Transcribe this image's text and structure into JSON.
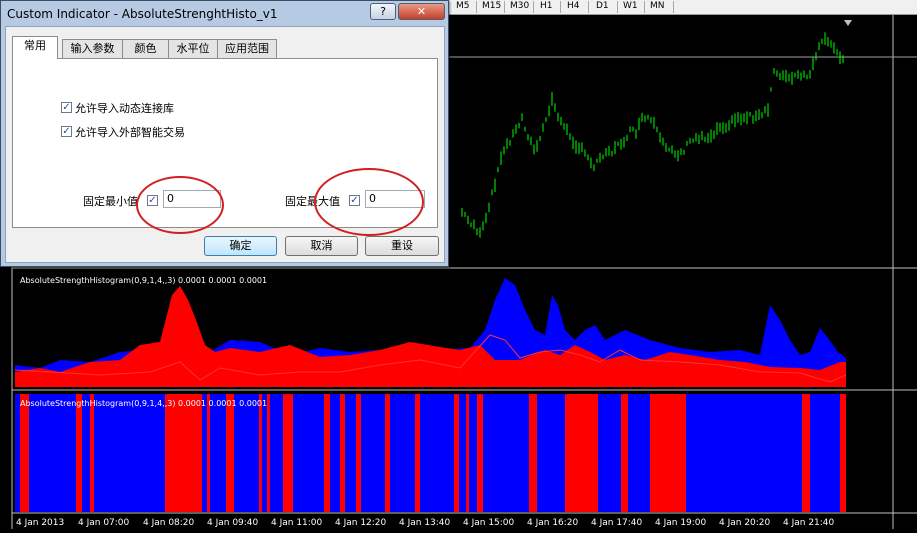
{
  "toolbar": {
    "timeframes": [
      "M5",
      "M15",
      "M30",
      "H1",
      "H4",
      "D1",
      "W1",
      "MN"
    ]
  },
  "chart": {
    "colors": {
      "background": "#000000",
      "candles": "#00ff00",
      "histogram_red": "#ff0000",
      "histogram_blue": "#0000ff",
      "line_red": "#ff3030",
      "grid": "#c0c0c0"
    },
    "price_path": [
      [
        462,
        212
      ],
      [
        468,
        220
      ],
      [
        474,
        225
      ],
      [
        480,
        235
      ],
      [
        486,
        220
      ],
      [
        492,
        195
      ],
      [
        498,
        170
      ],
      [
        504,
        150
      ],
      [
        510,
        140
      ],
      [
        516,
        130
      ],
      [
        522,
        118
      ],
      [
        528,
        135
      ],
      [
        534,
        150
      ],
      [
        540,
        140
      ],
      [
        546,
        120
      ],
      [
        552,
        100
      ],
      [
        558,
        115
      ],
      [
        564,
        128
      ],
      [
        570,
        135
      ],
      [
        576,
        145
      ],
      [
        582,
        150
      ],
      [
        588,
        158
      ],
      [
        594,
        165
      ],
      [
        600,
        158
      ],
      [
        606,
        150
      ],
      [
        612,
        152
      ],
      [
        618,
        146
      ],
      [
        624,
        140
      ],
      [
        630,
        132
      ],
      [
        636,
        132
      ],
      [
        642,
        120
      ],
      [
        648,
        118
      ],
      [
        654,
        125
      ],
      [
        660,
        140
      ],
      [
        666,
        148
      ],
      [
        672,
        148
      ],
      [
        678,
        155
      ],
      [
        684,
        150
      ],
      [
        690,
        142
      ],
      [
        696,
        138
      ],
      [
        702,
        136
      ],
      [
        708,
        138
      ],
      [
        714,
        132
      ],
      [
        720,
        126
      ],
      [
        726,
        125
      ],
      [
        732,
        122
      ],
      [
        738,
        118
      ],
      [
        744,
        118
      ],
      [
        750,
        115
      ],
      [
        756,
        118
      ],
      [
        762,
        115
      ],
      [
        768,
        110
      ],
      [
        774,
        70
      ],
      [
        780,
        74
      ],
      [
        786,
        78
      ],
      [
        792,
        78
      ],
      [
        798,
        76
      ],
      [
        804,
        77
      ],
      [
        810,
        74
      ],
      [
        816,
        58
      ],
      [
        822,
        40
      ],
      [
        828,
        43
      ],
      [
        834,
        48
      ],
      [
        840,
        55
      ],
      [
        846,
        58
      ]
    ],
    "indicator1": {
      "label": "AbsoluteStrengthHistogram(0,9,1,4,,3) 0.0001 0.0001 0.0001",
      "blue_profile": [
        [
          15,
          365
        ],
        [
          40,
          368
        ],
        [
          60,
          360
        ],
        [
          90,
          362
        ],
        [
          120,
          352
        ],
        [
          140,
          350
        ],
        [
          170,
          355
        ],
        [
          200,
          358
        ],
        [
          230,
          340
        ],
        [
          260,
          342
        ],
        [
          290,
          355
        ],
        [
          320,
          348
        ],
        [
          350,
          352
        ],
        [
          380,
          350
        ],
        [
          410,
          345
        ],
        [
          440,
          350
        ],
        [
          470,
          348
        ],
        [
          485,
          330
        ],
        [
          495,
          300
        ],
        [
          505,
          278
        ],
        [
          515,
          285
        ],
        [
          525,
          310
        ],
        [
          535,
          330
        ],
        [
          545,
          335
        ],
        [
          552,
          295
        ],
        [
          558,
          305
        ],
        [
          565,
          330
        ],
        [
          575,
          340
        ],
        [
          585,
          330
        ],
        [
          595,
          325
        ],
        [
          605,
          340
        ],
        [
          625,
          330
        ],
        [
          650,
          340
        ],
        [
          680,
          348
        ],
        [
          710,
          352
        ],
        [
          740,
          350
        ],
        [
          760,
          355
        ],
        [
          770,
          305
        ],
        [
          780,
          320
        ],
        [
          790,
          340
        ],
        [
          800,
          355
        ],
        [
          810,
          352
        ],
        [
          820,
          328
        ],
        [
          828,
          338
        ],
        [
          838,
          352
        ],
        [
          846,
          358
        ]
      ],
      "red_profile": [
        [
          15,
          372
        ],
        [
          40,
          368
        ],
        [
          60,
          372
        ],
        [
          90,
          362
        ],
        [
          120,
          360
        ],
        [
          140,
          345
        ],
        [
          160,
          342
        ],
        [
          172,
          295
        ],
        [
          180,
          286
        ],
        [
          188,
          300
        ],
        [
          196,
          320
        ],
        [
          205,
          345
        ],
        [
          215,
          352
        ],
        [
          230,
          348
        ],
        [
          260,
          352
        ],
        [
          290,
          345
        ],
        [
          320,
          357
        ],
        [
          350,
          355
        ],
        [
          380,
          350
        ],
        [
          410,
          342
        ],
        [
          440,
          347
        ],
        [
          460,
          350
        ],
        [
          480,
          345
        ],
        [
          495,
          360
        ],
        [
          520,
          360
        ],
        [
          545,
          350
        ],
        [
          560,
          355
        ],
        [
          575,
          345
        ],
        [
          590,
          352
        ],
        [
          605,
          360
        ],
        [
          625,
          355
        ],
        [
          645,
          360
        ],
        [
          670,
          352
        ],
        [
          690,
          355
        ],
        [
          720,
          360
        ],
        [
          745,
          362
        ],
        [
          770,
          367
        ],
        [
          800,
          368
        ],
        [
          820,
          370
        ],
        [
          840,
          362
        ],
        [
          846,
          362
        ]
      ],
      "red_line": [
        [
          15,
          370
        ],
        [
          50,
          372
        ],
        [
          100,
          375
        ],
        [
          150,
          372
        ],
        [
          180,
          362
        ],
        [
          200,
          380
        ],
        [
          220,
          368
        ],
        [
          260,
          375
        ],
        [
          300,
          372
        ],
        [
          340,
          372
        ],
        [
          380,
          365
        ],
        [
          420,
          360
        ],
        [
          460,
          368
        ],
        [
          490,
          335
        ],
        [
          505,
          340
        ],
        [
          520,
          358
        ],
        [
          540,
          352
        ],
        [
          560,
          350
        ],
        [
          580,
          355
        ],
        [
          600,
          362
        ],
        [
          620,
          350
        ],
        [
          640,
          360
        ],
        [
          680,
          362
        ],
        [
          720,
          365
        ],
        [
          760,
          372
        ],
        [
          800,
          373
        ],
        [
          830,
          382
        ],
        [
          846,
          375
        ]
      ]
    },
    "indicator2": {
      "label": "AbsoluteStrengthHistogram(0,9,1,4,,3) 0.0001 0.0001 0.0001",
      "red_segments": [
        [
          20,
          29
        ],
        [
          76,
          82
        ],
        [
          90,
          94
        ],
        [
          165,
          202
        ],
        [
          207,
          210
        ],
        [
          226,
          234
        ],
        [
          259,
          262
        ],
        [
          267,
          270
        ],
        [
          283,
          293
        ],
        [
          324,
          330
        ],
        [
          340,
          345
        ],
        [
          356,
          361
        ],
        [
          385,
          390
        ],
        [
          415,
          420
        ],
        [
          454,
          459
        ],
        [
          466,
          469
        ],
        [
          477,
          483
        ],
        [
          529,
          537
        ],
        [
          565,
          598
        ],
        [
          621,
          628
        ],
        [
          650,
          686
        ],
        [
          802,
          810
        ],
        [
          840,
          846
        ]
      ]
    }
  },
  "x_axis": {
    "labels": [
      "4 Jan 2013",
      "4 Jan 07:00",
      "4 Jan 08:20",
      "4 Jan 09:40",
      "4 Jan 11:00",
      "4 Jan 12:20",
      "4 Jan 13:40",
      "4 Jan 15:00",
      "4 Jan 16:20",
      "4 Jan 17:40",
      "4 Jan 19:00",
      "4 Jan 20:20",
      "4 Jan 21:40"
    ]
  },
  "dialog": {
    "title": "Custom Indicator - AbsoluteStrenghtHisto_v1",
    "help": "?",
    "close": "✕",
    "tabs": [
      "常用",
      "输入参数",
      "颜色",
      "水平位",
      "应用范围"
    ],
    "allow_dll": "允许导入动态连接库",
    "allow_experts": "允许导入外部智能交易",
    "fixed_min_label": "固定最小值",
    "fixed_min_value": "0",
    "fixed_max_label": "固定最大值",
    "fixed_max_value": "0",
    "check_mark": "✓",
    "ok": "确定",
    "cancel": "取消",
    "reset": "重设"
  }
}
